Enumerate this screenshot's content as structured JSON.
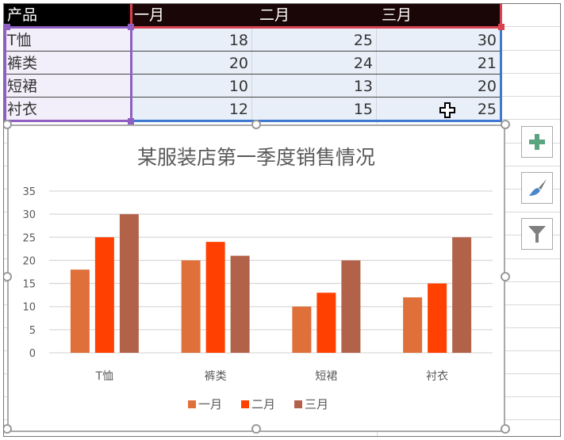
{
  "sheet": {
    "header": [
      "产品",
      "一月",
      "二月",
      "三月"
    ],
    "rows": [
      {
        "product": "T恤",
        "values": [
          "18",
          "25",
          "30"
        ]
      },
      {
        "product": "裤类",
        "values": [
          "20",
          "24",
          "21"
        ]
      },
      {
        "product": "短裙",
        "values": [
          "10",
          "13",
          "20"
        ]
      },
      {
        "product": "衬衣",
        "values": [
          "12",
          "15",
          "25"
        ]
      }
    ]
  },
  "side_buttons": [
    {
      "name": "chart-elements",
      "icon": "plus-icon",
      "color": "#5aa47f"
    },
    {
      "name": "chart-styles",
      "icon": "paintbrush-icon",
      "color": "#4a86c8"
    },
    {
      "name": "chart-filters",
      "icon": "funnel-icon",
      "color": "#7f7f7f"
    }
  ],
  "chart_data": {
    "type": "bar",
    "title": "某服装店第一季度销售情况",
    "categories": [
      "T恤",
      "裤类",
      "短裙",
      "衬衣"
    ],
    "series": [
      {
        "name": "一月",
        "color": "#e0703a",
        "values": [
          18,
          20,
          10,
          12
        ]
      },
      {
        "name": "二月",
        "color": "#ff4000",
        "values": [
          25,
          24,
          13,
          15
        ]
      },
      {
        "name": "三月",
        "color": "#b3624a",
        "values": [
          30,
          21,
          20,
          25
        ]
      }
    ],
    "yticks": [
      "0",
      "5",
      "10",
      "15",
      "20",
      "25",
      "30",
      "35"
    ],
    "ylim": [
      0,
      35
    ],
    "xlabel": "",
    "ylabel": "",
    "grid": true,
    "legend": "bottom"
  }
}
